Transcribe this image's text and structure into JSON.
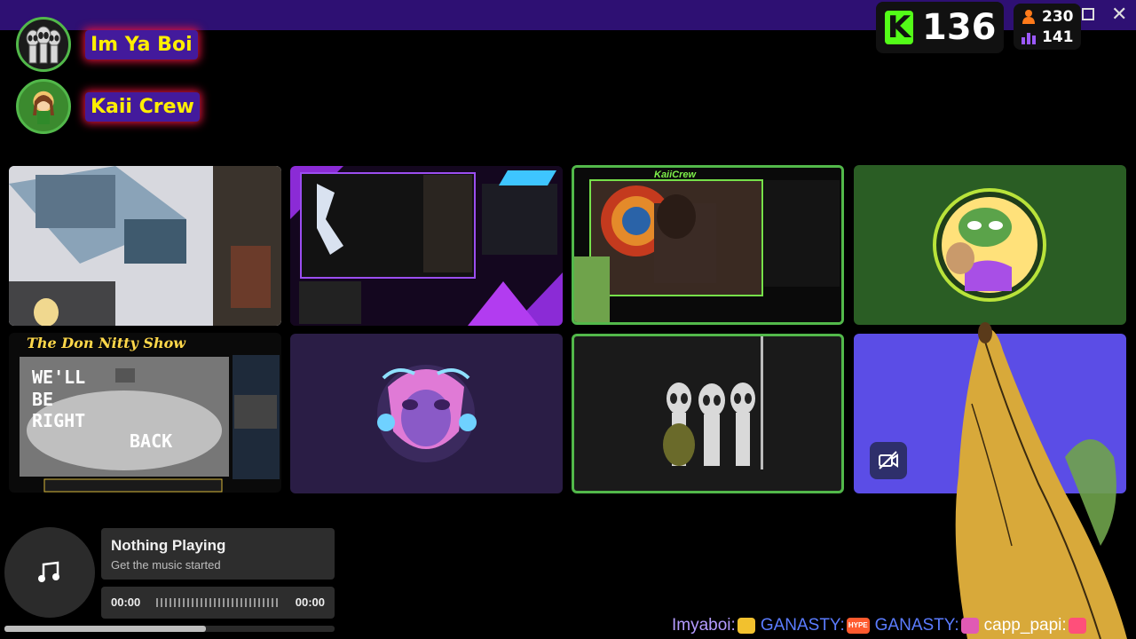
{
  "hosts": [
    {
      "name": "Im Ya Boi"
    },
    {
      "name": "Kaii Crew"
    }
  ],
  "kick": {
    "logo_letter": "K",
    "count": "136",
    "color": "#53fc18"
  },
  "stats": {
    "stat_a": "230",
    "stat_b": "141"
  },
  "tiles": {
    "wait_banner": "The Don Nitty Show",
    "wait_text": [
      "WE'LL",
      "BE",
      "RIGHT",
      "BACK"
    ],
    "overlay_label": "KaiiCrew"
  },
  "music": {
    "title": "Nothing Playing",
    "subtitle": "Get the music started",
    "time_current": "00:00",
    "time_total": "00:00",
    "progress": 0.61
  },
  "chat_ticker": [
    {
      "user": "Imyaboi:",
      "color": "#b49bff",
      "emote_color": "#f2c12e"
    },
    {
      "user": "GANASTY:",
      "color": "#5b7cff",
      "emote_label": "HYPE",
      "emote_color": "#ff5a2e"
    },
    {
      "user": "GANASTY:",
      "color": "#5b7cff",
      "emote_color": "#e05ab4"
    },
    {
      "user": "capp_papi:",
      "color": "#ffffff",
      "emote_color": "#ff4f7a"
    }
  ]
}
